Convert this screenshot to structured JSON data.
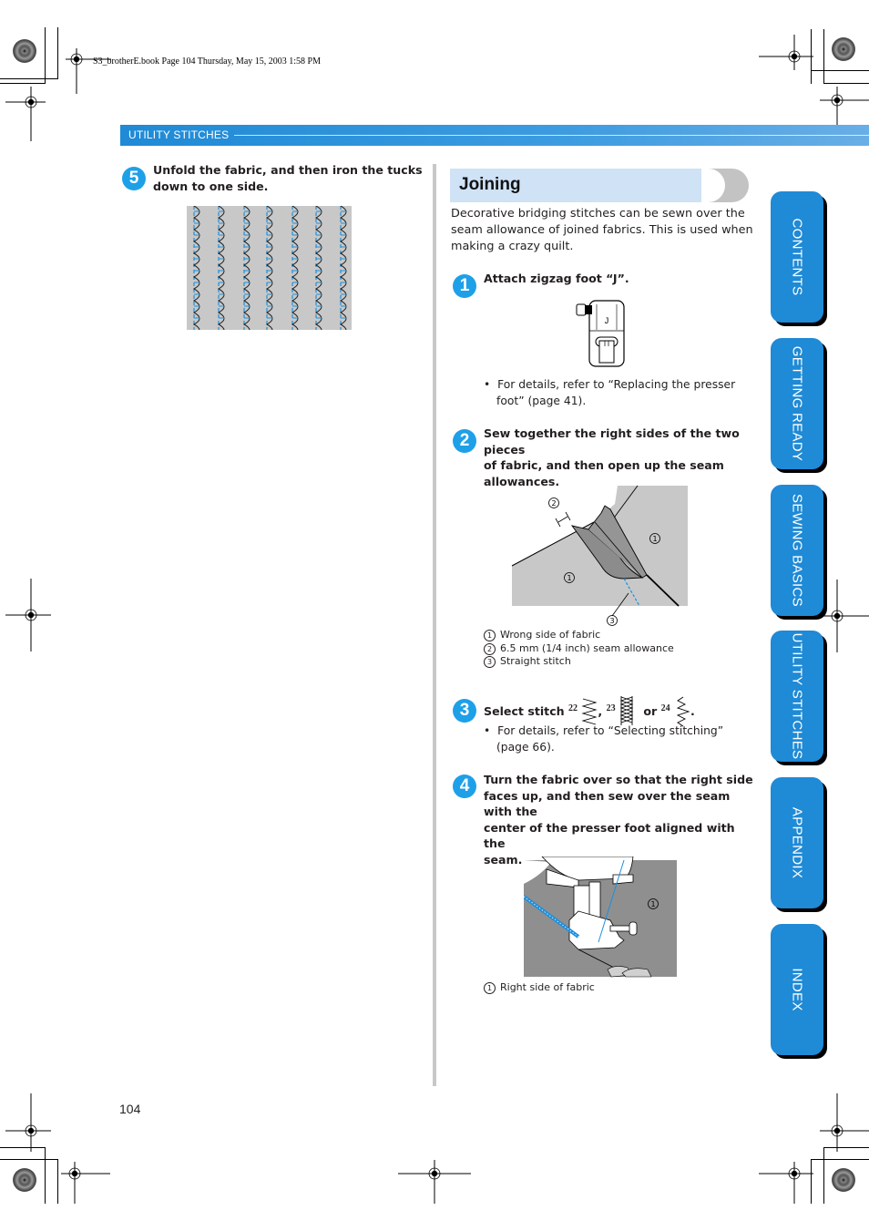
{
  "file_header": "S3_brotherE.book  Page 104  Thursday, May 15, 2003  1:58 PM",
  "chapter_bar": {
    "label": "UTILITY STITCHES"
  },
  "left_column": {
    "step5": {
      "number": "5",
      "text_line1": "Unfold the fabric, and then iron the tucks",
      "text_line2": "down to one side."
    }
  },
  "section": {
    "title": "Joining",
    "intro_lines": [
      "Decorative bridging stitches can be sewn over the",
      "seam allowance of joined fabrics. This is used when",
      "making a crazy quilt."
    ]
  },
  "steps": [
    {
      "number": "1",
      "lines": [
        "Attach zigzag foot “J”."
      ],
      "figure_label": "J",
      "bullet_lines": [
        "For details, refer to “Replacing the presser",
        "foot” (page 41)."
      ]
    },
    {
      "number": "2",
      "lines": [
        "Sew together the right sides of the two pieces",
        "of fabric, and then open up the seam",
        "allowances."
      ],
      "callouts": [
        "1",
        "2",
        "3"
      ],
      "legend": [
        {
          "num": "1",
          "text": "Wrong side of fabric"
        },
        {
          "num": "2",
          "text": "6.5 mm (1/4 inch) seam allowance"
        },
        {
          "num": "3",
          "text": "Straight stitch"
        }
      ]
    },
    {
      "number": "3",
      "prefix": "Select stitch",
      "stitches": [
        "22",
        "23",
        "24"
      ],
      "sep_comma": ",",
      "sep_or": "or",
      "suffix": ".",
      "bullet_lines": [
        "For details, refer to “Selecting stitching”",
        "(page 66)."
      ]
    },
    {
      "number": "4",
      "lines": [
        "Turn the fabric over so that the right side",
        "faces up, and then sew over the seam with the",
        "center of the presser foot aligned with the",
        "seam."
      ],
      "callouts": [
        "1"
      ],
      "legend": [
        {
          "num": "1",
          "text": "Right side of fabric"
        }
      ]
    }
  ],
  "side_tabs": [
    {
      "label": "CONTENTS"
    },
    {
      "label": "GETTING READY"
    },
    {
      "label": "SEWING BASICS"
    },
    {
      "label": "UTILITY STITCHES"
    },
    {
      "label": "APPENDIX"
    },
    {
      "label": "INDEX"
    }
  ],
  "page_number": "104",
  "colors": {
    "accent_blue": "#1f8ad6",
    "badge_blue": "#1ea0e8",
    "title_bg": "#cfe2f6",
    "fabric_gray": "#c8c8c8"
  }
}
